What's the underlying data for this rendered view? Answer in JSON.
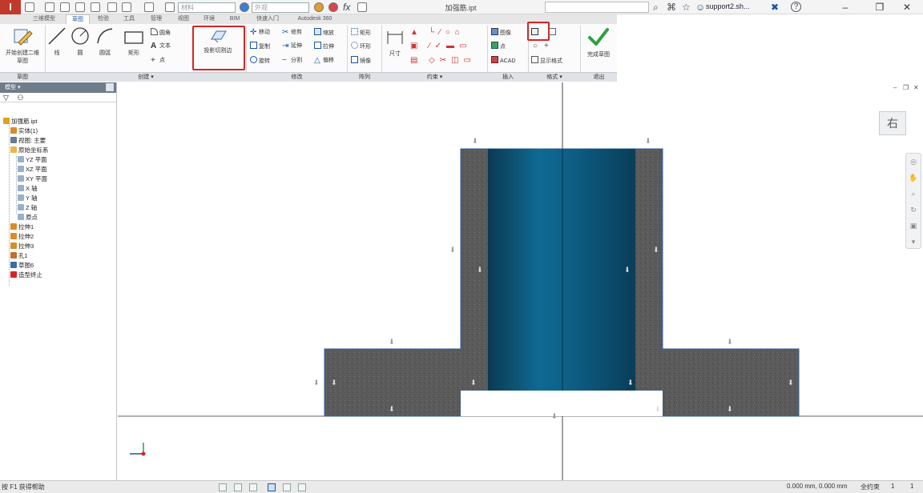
{
  "titlebar": {
    "app_logo": "I",
    "material_value": "材料",
    "appearance_value": "外观",
    "formula_icon": "fx",
    "document_title": "加强筋.ipt",
    "user_name": "support2.sh...",
    "help_icon": "?"
  },
  "tabs": [
    "三维模型",
    "草图",
    "检验",
    "工具",
    "管理",
    "视图",
    "环境",
    "BIM",
    "快速入门",
    "Autodesk 360"
  ],
  "ribbon": {
    "sketch_panel": {
      "start_2d_sketch_label": "开始创建二维草图",
      "title": "草图"
    },
    "create_panel": {
      "title": "创建",
      "line_label": "线",
      "circle_label": "圆",
      "arc_label": "圆弧",
      "rectangle_label": "矩形",
      "fillet_label": "圆角",
      "text_label": "文本",
      "point_label": "点",
      "project_geometry_label": "投影切割边"
    },
    "modify_panel": {
      "title": "修改",
      "move_label": "移动",
      "trim_label": "修剪",
      "scale_label": "缩放",
      "copy_label": "复制",
      "extend_label": "延伸",
      "stretch_label": "拉伸",
      "rotate_label": "旋转",
      "split_label": "分割",
      "offset_label": "偏移"
    },
    "pattern_panel": {
      "title": "阵列",
      "rectangular_label": "矩形",
      "circular_label": "环形",
      "mirror_label": "镜像"
    },
    "constrain_panel": {
      "title": "约束",
      "dimension_label": "尺寸"
    },
    "insert_panel": {
      "title": "插入",
      "image_label": "图像",
      "points_label": "点",
      "acad_label": "ACAD"
    },
    "format_panel": {
      "title": "格式",
      "show_format_label": "显示格式"
    },
    "exit_panel": {
      "title": "退出",
      "finish_sketch_label": "完成草图"
    }
  },
  "browser": {
    "header": "模型",
    "search_icon": "binoculars",
    "tree": [
      {
        "label": "加强筋.ipt",
        "indent": 0,
        "icon": "part-icon"
      },
      {
        "label": "实体(1)",
        "indent": 1,
        "icon": "solid-icon"
      },
      {
        "label": "视图: 主要",
        "indent": 1,
        "icon": "view-icon"
      },
      {
        "label": "原始坐标系",
        "indent": 1,
        "icon": "folder-icon"
      },
      {
        "label": "YZ 平面",
        "indent": 2,
        "icon": "plane-icon"
      },
      {
        "label": "XZ 平面",
        "indent": 2,
        "icon": "plane-icon"
      },
      {
        "label": "XY 平面",
        "indent": 2,
        "icon": "plane-icon"
      },
      {
        "label": "X 轴",
        "indent": 2,
        "icon": "axis-icon"
      },
      {
        "label": "Y 轴",
        "indent": 2,
        "icon": "axis-icon"
      },
      {
        "label": "Z 轴",
        "indent": 2,
        "icon": "axis-icon"
      },
      {
        "label": "原点",
        "indent": 2,
        "icon": "origin-icon"
      },
      {
        "label": "拉伸1",
        "indent": 1,
        "icon": "extrude-icon"
      },
      {
        "label": "拉伸2",
        "indent": 1,
        "icon": "extrude-icon"
      },
      {
        "label": "拉伸3",
        "indent": 1,
        "icon": "extrude-icon"
      },
      {
        "label": "孔1",
        "indent": 1,
        "icon": "hole-icon"
      },
      {
        "label": "草图6",
        "indent": 1,
        "icon": "sketch-icon"
      },
      {
        "label": "造型终止",
        "indent": 1,
        "icon": "end-of-part-icon"
      }
    ]
  },
  "graphics": {
    "view_cube_label": "右"
  },
  "statusbar": {
    "hint": "按 F1 获得帮助",
    "coordinates": "0.000 mm, 0.000 mm",
    "status": "全约束",
    "count_a": "1",
    "count_b": "1"
  },
  "colors": {
    "ribbon_highlight": "#d42525",
    "part_section": "#5a5a5a",
    "projected_face": "#0f5f86",
    "finish_check": "#2ea043"
  }
}
